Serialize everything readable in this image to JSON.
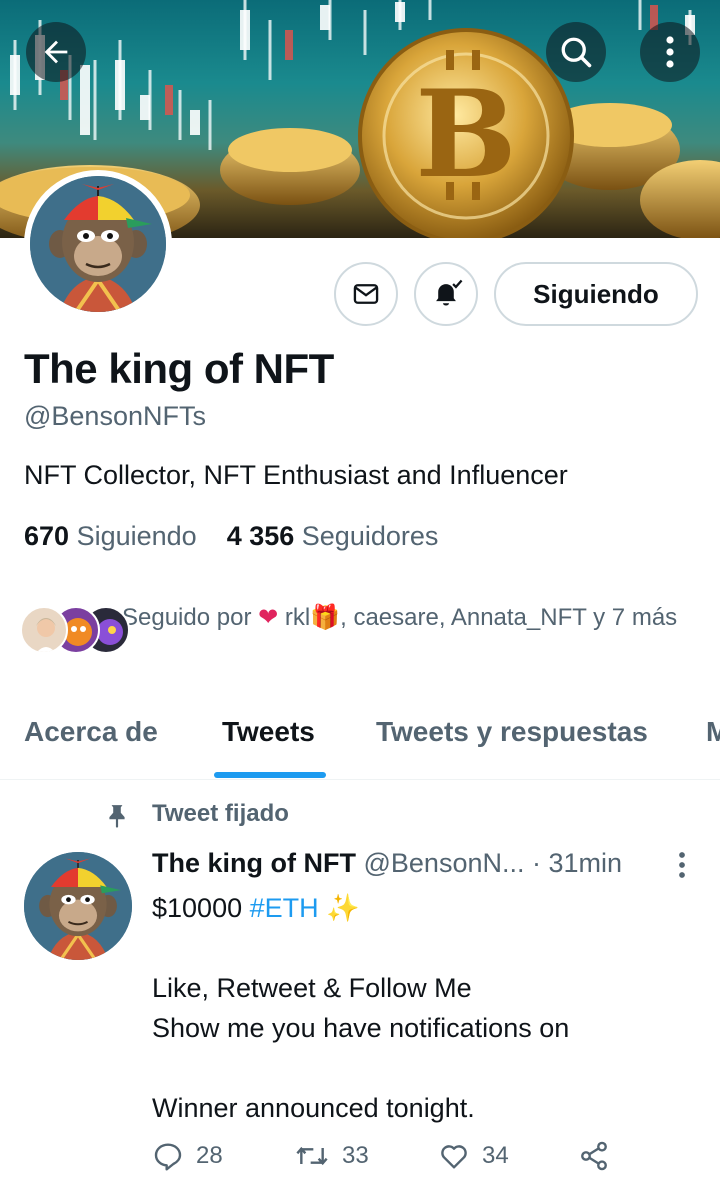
{
  "header": {
    "back_icon": "arrow-left-icon",
    "search_icon": "search-icon",
    "more_icon": "more-vertical-icon"
  },
  "profile": {
    "name": "The king of NFT",
    "handle": "@BensonNFTs",
    "bio": "NFT Collector, NFT Enthusiast and Influencer",
    "following_count": "670",
    "following_label": "Siguiendo",
    "followers_count": "4 356",
    "followers_label": "Seguidores",
    "follow_button_label": "Siguiendo",
    "followed_by_prefix": "Seguido por",
    "followed_by_names": "rkl",
    "followed_by_rest": ", caesare, Annata_NFT y 7 más"
  },
  "tabs": [
    {
      "label": "Acerca de"
    },
    {
      "label": "Tweets"
    },
    {
      "label": "Tweets y respuestas"
    },
    {
      "label": "M"
    }
  ],
  "tweet": {
    "pinned_label": "Tweet fijado",
    "author_name": "The king of NFT",
    "author_handle": "@BensonN...",
    "time": "· 31min",
    "amount": "$10000",
    "hashtag": "#ETH",
    "line1": "Like, Retweet & Follow Me",
    "line2": "Show me you have notifications on",
    "line3": "Winner announced tonight.",
    "replies": "28",
    "retweets": "33",
    "likes": "34"
  },
  "colors": {
    "accent": "#1d9bf0",
    "text_primary": "#0f1419",
    "text_secondary": "#536471",
    "heart": "#e0245e"
  }
}
